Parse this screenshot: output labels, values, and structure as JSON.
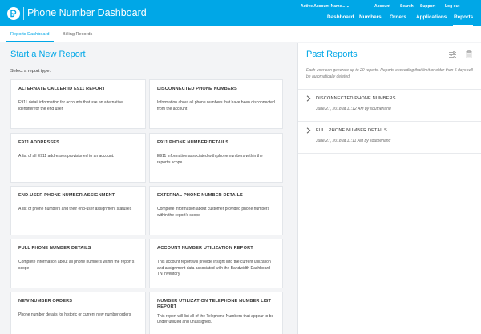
{
  "header": {
    "title": "Phone Number Dashboard",
    "util_nav": {
      "account": "Active Account Name...",
      "account_link": "Account",
      "search": "Search",
      "support": "Support",
      "logout": "Log out"
    },
    "main_nav": [
      "Dashboard",
      "Numbers",
      "Orders",
      "Applications",
      "Reports"
    ],
    "active_tab": "Reports",
    "brand_color": "#00a7e7"
  },
  "subtabs": [
    "Reports Dashboard",
    "Billing Records"
  ],
  "left": {
    "title": "Start a New Report",
    "select_label": "Select a report type:",
    "cards": [
      {
        "title": "ALTERNATE CALLER ID E911 REPORT",
        "desc": "E911 detail information for accounts that use an alternative identifier for the end user"
      },
      {
        "title": "DISCONNECTED PHONE NUMBERS",
        "desc": "Information about all phone numbers that have been disconnected from the account"
      },
      {
        "title": "E911 ADDRESSES",
        "desc": "A list of all E911 addresses provisioned to an account."
      },
      {
        "title": "E911 PHONE NUMBER DETAILS",
        "desc": "E911 information associated with phone numbers within the report's scope"
      },
      {
        "title": "END-USER PHONE NUMBER ASSIGNMENT",
        "desc": "A list of phone numbers and their end-user assignment statuses"
      },
      {
        "title": "EXTERNAL PHONE NUMBER DETAILS",
        "desc": "Complete information about customer provided phone numbers within the report's scope"
      },
      {
        "title": "FULL PHONE NUMBER DETAILS",
        "desc": "Complete information about all phone numbers within the report's scope"
      },
      {
        "title": "ACCOUNT NUMBER UTILIZATION REPORT",
        "desc": "This account report will provide insight into the current utilization and assignment data associated with the Bandwidth Dashboard TN inventory"
      },
      {
        "title": "NEW NUMBER ORDERS",
        "desc": "Phone number details for historic or current new number orders"
      },
      {
        "title": "NUMBER UTILIZATION TELEPHONE NUMBER LIST REPORT",
        "desc": "This report will list all of the Telephone Numbers that appear to be under-utilized and unassigned."
      }
    ]
  },
  "right": {
    "title": "Past Reports",
    "note": "Each user can generate up to 20 reports. Reports exceeding that limit or older than 5 days will be automatically deleted.",
    "icons": {
      "filter": "filter-sliders-icon",
      "trash": "trash-icon",
      "chevron": "chevron-right-icon"
    },
    "items": [
      {
        "title": "DISCONNECTED PHONE NUMBERS",
        "meta": "June 27, 2018 at 11:12 AM by southerland"
      },
      {
        "title": "FULL PHONE NUMBER DETAILS",
        "meta": "June 27, 2018 at 11:11 AM by southerland"
      }
    ]
  }
}
